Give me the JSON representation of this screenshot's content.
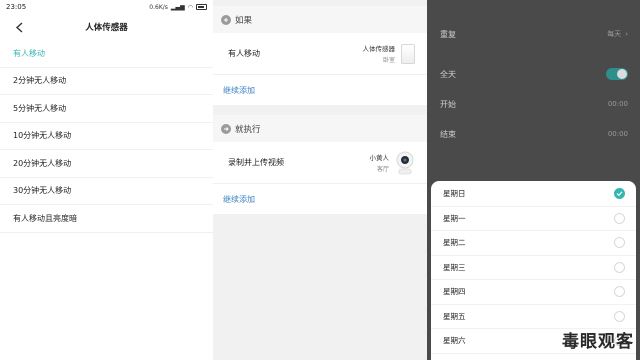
{
  "screen1": {
    "status": {
      "time": "23:05",
      "speed": "0.6K/s"
    },
    "title": "人体传感器",
    "options": [
      {
        "label": "有人移动",
        "selected": true
      },
      {
        "label": "2分钟无人移动",
        "selected": false
      },
      {
        "label": "5分钟无人移动",
        "selected": false
      },
      {
        "label": "10分钟无人移动",
        "selected": false
      },
      {
        "label": "20分钟无人移动",
        "selected": false
      },
      {
        "label": "30分钟无人移动",
        "selected": false
      },
      {
        "label": "有人移动且亮度暗",
        "selected": false
      }
    ]
  },
  "screen2": {
    "if_section": {
      "label": "如果",
      "card": {
        "title": "有人移动",
        "device": "人体传感器",
        "room": "卧室"
      },
      "add_label": "继续添加"
    },
    "then_section": {
      "label": "就执行",
      "card": {
        "title": "录制并上传视频",
        "device": "小黄人",
        "room": "客厅"
      },
      "add_label": "继续添加"
    }
  },
  "screen3": {
    "repeat": {
      "label": "重复",
      "value": "每天"
    },
    "all_day": {
      "label": "全天",
      "on": true
    },
    "start": {
      "label": "开始",
      "value": "00:00"
    },
    "end": {
      "label": "结束",
      "value": "00:00"
    },
    "days": [
      {
        "label": "星期日",
        "checked": true
      },
      {
        "label": "星期一",
        "checked": false
      },
      {
        "label": "星期二",
        "checked": false
      },
      {
        "label": "星期三",
        "checked": false
      },
      {
        "label": "星期四",
        "checked": false
      },
      {
        "label": "星期五",
        "checked": false
      },
      {
        "label": "星期六",
        "checked": false
      }
    ],
    "watermark": "毒眼观客"
  },
  "colors": {
    "accent": "#36b6b1",
    "link": "#3b83c5",
    "toggle_on": "#2d8f8b",
    "overlay": "#4a4a4a"
  },
  "icons": [
    "back-arrow-icon",
    "if-section-icon",
    "then-section-icon",
    "sensor-device-icon",
    "camera-device-icon",
    "check-icon"
  ]
}
